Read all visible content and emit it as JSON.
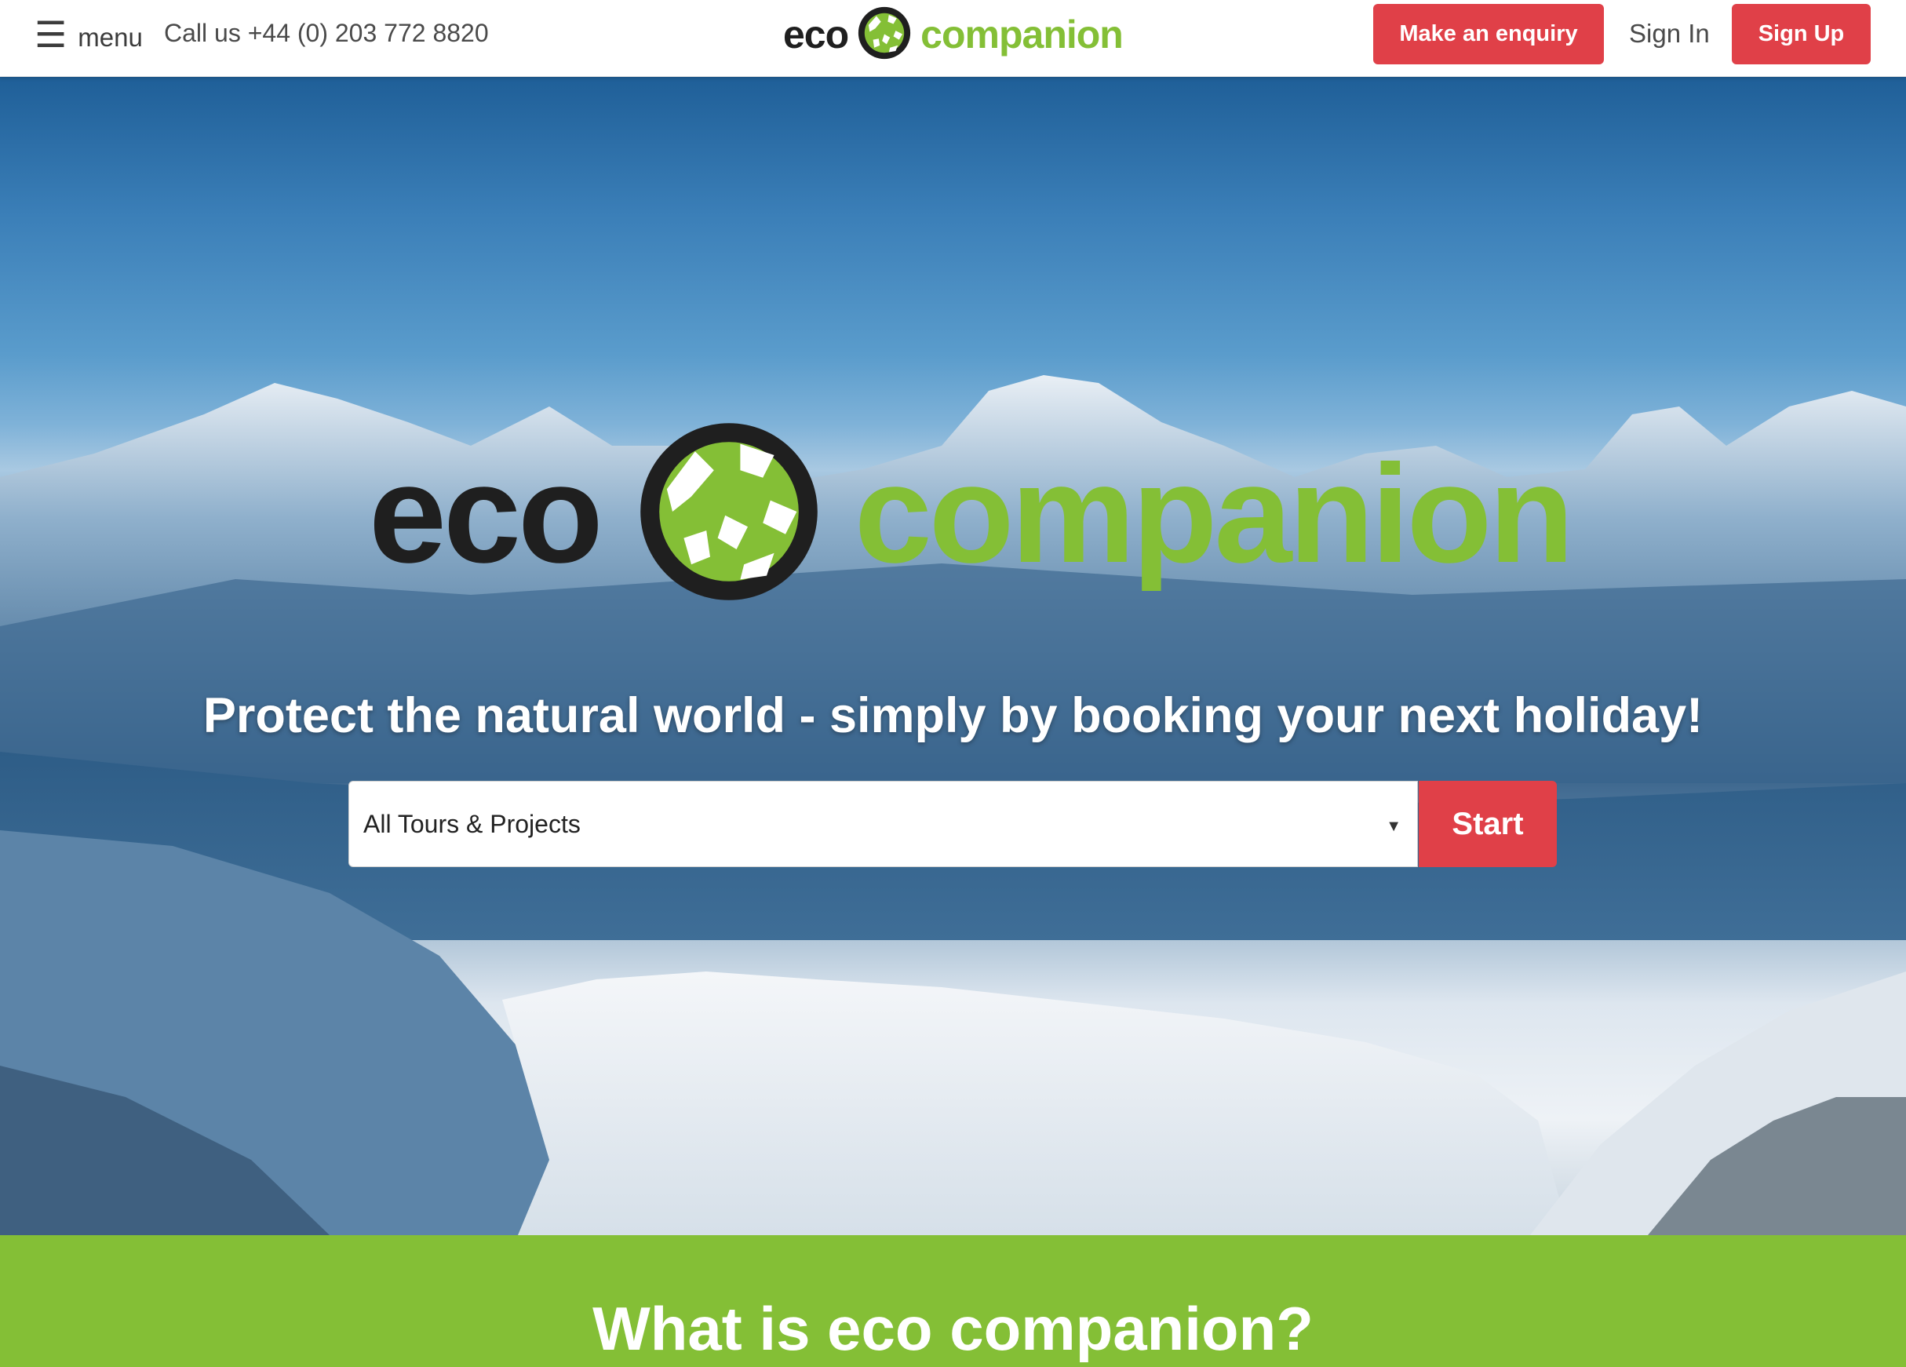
{
  "header": {
    "menu_icon": "hamburger-icon",
    "menu_label": "menu",
    "phone": "Call us +44 (0) 203 772 8820",
    "logo": {
      "eco": "eco",
      "companion": "companion"
    },
    "enquiry_label": "Make an enquiry",
    "signin_label": "Sign In",
    "signup_label": "Sign Up"
  },
  "hero": {
    "logo": {
      "eco": "eco",
      "companion": "companion"
    },
    "tagline": "Protect the natural world - simply by booking your next holiday!",
    "search": {
      "selected": "All Tours & Projects",
      "caret_icon": "dropdown-caret-icon",
      "start_label": "Start"
    }
  },
  "section": {
    "title": "What is eco companion?"
  },
  "colors": {
    "brand_green": "#84bf36",
    "brand_dark": "#1f1f1f",
    "accent_red": "#e04048",
    "white": "#ffffff"
  }
}
